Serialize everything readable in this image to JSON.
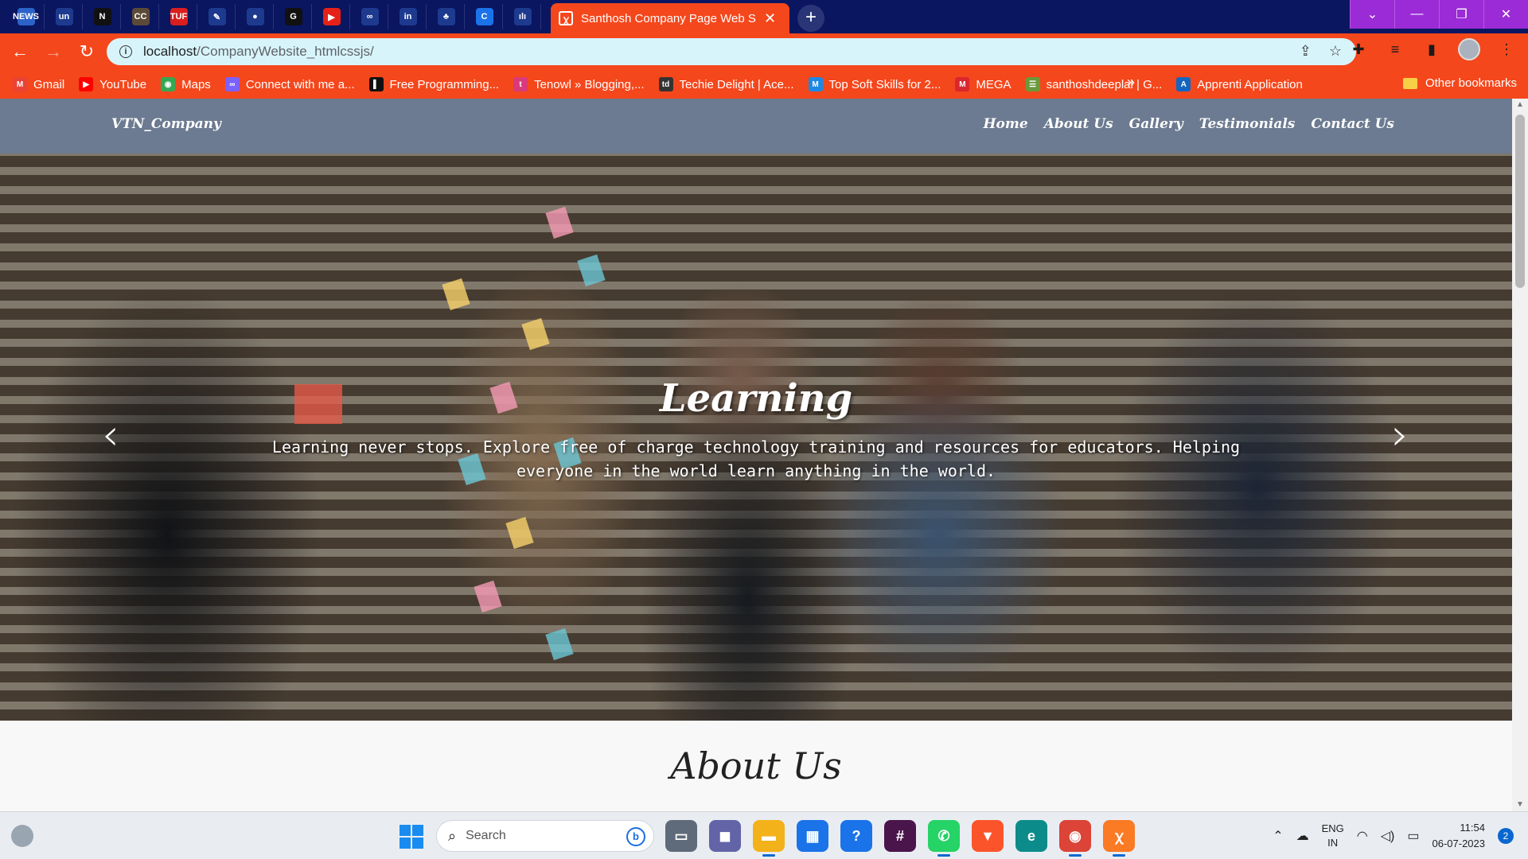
{
  "browser": {
    "pinned_tabs": [
      {
        "icon": "news-icon",
        "glyph": "NEWS",
        "color": "#2b63c9"
      },
      {
        "icon": "unstop-icon",
        "glyph": "un",
        "color": "#1d3a8f"
      },
      {
        "icon": "nxtwave-icon",
        "glyph": "N",
        "color": "#111111"
      },
      {
        "icon": "codechef-icon",
        "glyph": "CC",
        "color": "#5c4a38"
      },
      {
        "icon": "tup-icon",
        "glyph": "TUF",
        "color": "#d91e1e"
      },
      {
        "icon": "design-icon",
        "glyph": "✎",
        "color": "#1d3a8f"
      },
      {
        "icon": "github-icon",
        "glyph": "●",
        "color": "#1d3a8f"
      },
      {
        "icon": "chatgpt-icon",
        "glyph": "G",
        "color": "#111111"
      },
      {
        "icon": "youtube-icon",
        "glyph": "▶",
        "color": "#e62117"
      },
      {
        "icon": "connect-icon",
        "glyph": "∞",
        "color": "#1d3a8f"
      },
      {
        "icon": "linkedin-icon",
        "glyph": "in",
        "color": "#1d3a8f"
      },
      {
        "icon": "leaf-icon",
        "glyph": "♣",
        "color": "#1d3a8f"
      },
      {
        "icon": "c-icon",
        "glyph": "C",
        "color": "#1a73e8"
      },
      {
        "icon": "cisco-icon",
        "glyph": "ılı",
        "color": "#1d3a8f"
      }
    ],
    "active_tab": {
      "title": "Santhosh Company Page Web Site"
    },
    "new_tab_label": "+",
    "address": {
      "host": "localhost",
      "path": "/CompanyWebsite_htmlcssjs/"
    },
    "bookmarks": [
      {
        "label": "Gmail",
        "icon": "gmail-icon",
        "glyph": "M",
        "color": "#ea4335"
      },
      {
        "label": "YouTube",
        "icon": "youtube-icon",
        "glyph": "▶",
        "color": "#ff0000"
      },
      {
        "label": "Maps",
        "icon": "maps-icon",
        "glyph": "◉",
        "color": "#34a853"
      },
      {
        "label": "Connect with me a...",
        "icon": "connect-icon",
        "glyph": "∞",
        "color": "#7b61ff"
      },
      {
        "label": "Free Programming...",
        "icon": "programming-icon",
        "glyph": "▌",
        "color": "#111111"
      },
      {
        "label": "Tenowl » Blogging,...",
        "icon": "tenowl-icon",
        "glyph": "t",
        "color": "#d93a7a"
      },
      {
        "label": "Techie Delight | Ace...",
        "icon": "techiedelight-icon",
        "glyph": "td",
        "color": "#333333"
      },
      {
        "label": "Top Soft Skills for 2...",
        "icon": "softskills-icon",
        "glyph": "M",
        "color": "#1e88e5"
      },
      {
        "label": "MEGA",
        "icon": "mega-icon",
        "glyph": "M",
        "color": "#d9272e"
      },
      {
        "label": "santhoshdeeplal | G...",
        "icon": "leetcode-icon",
        "glyph": "☰",
        "color": "#6a9a3a"
      },
      {
        "label": "Apprenti Application",
        "icon": "apprenti-icon",
        "glyph": "A",
        "color": "#1565c0"
      }
    ],
    "bookmarks_more": "»",
    "other_bookmarks": "Other bookmarks"
  },
  "site": {
    "brand": "VTN_Company",
    "nav": [
      "Home",
      "About Us",
      "Gallery",
      "Testimonials",
      "Contact Us"
    ],
    "hero": {
      "title": "Learning",
      "text": "Learning never stops. Explore free of charge technology training and resources for educators. Helping everyone in the world learn anything in the world.",
      "prev": "‹",
      "next": "›"
    },
    "about_title": "About Us"
  },
  "taskbar": {
    "search_placeholder": "Search",
    "apps": [
      {
        "icon": "task-view-icon",
        "glyph": "▭",
        "color": "#5f6b7a"
      },
      {
        "icon": "teams-chat-icon",
        "glyph": "◼",
        "color": "#6264a7"
      },
      {
        "icon": "file-explorer-icon",
        "glyph": "▬",
        "color": "#f3b21a"
      },
      {
        "icon": "store-icon",
        "glyph": "▦",
        "color": "#1a73e8"
      },
      {
        "icon": "help-icon",
        "glyph": "?",
        "color": "#1a73e8"
      },
      {
        "icon": "slack-icon",
        "glyph": "#",
        "color": "#4a154b"
      },
      {
        "icon": "whatsapp-icon",
        "glyph": "✆",
        "color": "#25d366"
      },
      {
        "icon": "brave-icon",
        "glyph": "▼",
        "color": "#fb542b"
      },
      {
        "icon": "edge-icon",
        "glyph": "e",
        "color": "#0c8b8b"
      },
      {
        "icon": "chrome-icon",
        "glyph": "◉",
        "color": "#db4437"
      },
      {
        "icon": "xampp-icon",
        "glyph": "ꭓ",
        "color": "#fb7a24"
      }
    ],
    "active_apps": [
      "chrome-icon",
      "xampp-icon",
      "whatsapp-icon",
      "file-explorer-icon"
    ],
    "language": {
      "line1": "ENG",
      "line2": "IN"
    },
    "time": "11:54",
    "date": "06-07-2023",
    "notification_count": "2"
  }
}
